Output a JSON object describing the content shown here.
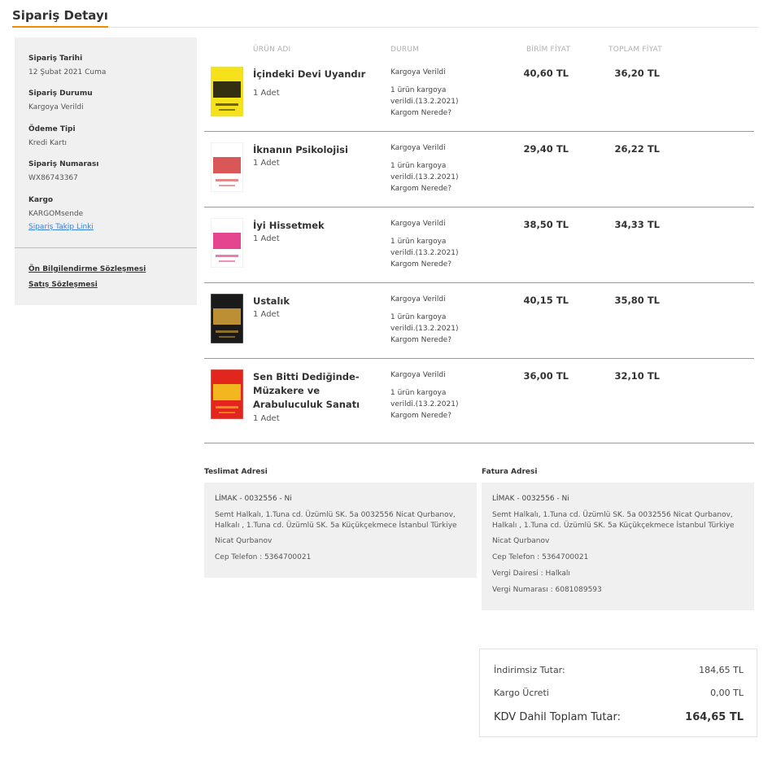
{
  "page": {
    "title": "Sipariş Detayı"
  },
  "sidebar": {
    "order_date": {
      "label": "Sipariş Tarihi",
      "value": "12 Şubat 2021 Cuma"
    },
    "order_status": {
      "label": "Sipariş Durumu",
      "value": "Kargoya Verildi"
    },
    "payment_type": {
      "label": "Ödeme Tipi",
      "value": "Kredi Kartı"
    },
    "order_number": {
      "label": "Sipariş Numarası",
      "value": "WX86743367"
    },
    "cargo": {
      "label": "Kargo",
      "value": "KARGOMsende",
      "tracking_link": "Sipariş Takip Linki"
    },
    "contracts": [
      "Ön Bilgilendirme Sözleşmesi",
      "Satış Sözleşmesi"
    ]
  },
  "table": {
    "headers": {
      "product": "ÜRÜN ADI",
      "status": "DURUM",
      "unit_price": "BİRİM FİYAT",
      "total_price": "TOPLAM FİYAT"
    },
    "items": [
      {
        "name": "İçindeki Devi Uyandır",
        "qty": "1 Adet",
        "status": "Kargoya Verildi",
        "status_detail": "1 ürün kargoya verildi.(13.2.2021)",
        "tracking": "Kargom Nerede?",
        "unit_price": "40,60 TL",
        "total_price": "36,20 TL",
        "cover": {
          "icon": "book-cover-icon",
          "colors": [
            "#f5e21a",
            "#111111"
          ],
          "text": "DEVİ"
        }
      },
      {
        "name": "İknanın Psikolojisi",
        "qty": "1 Adet",
        "status": "Kargoya Verildi",
        "status_detail": "1 ürün kargoya verildi.(13.2.2021)",
        "tracking": "Kargom Nerede?",
        "unit_price": "29,40 TL",
        "total_price": "26,22 TL",
        "cover": {
          "icon": "book-cover-icon",
          "colors": [
            "#ffffff",
            "#d23a3a"
          ],
          "text": "İKNANIN PSİKOLOJİSİ"
        }
      },
      {
        "name": "İyi Hissetmek",
        "qty": "1 Adet",
        "status": "Kargoya Verildi",
        "status_detail": "1 ürün kargoya verildi.(13.2.2021)",
        "tracking": "Kargom Nerede?",
        "unit_price": "38,50 TL",
        "total_price": "34,33 TL",
        "cover": {
          "icon": "book-cover-icon",
          "colors": [
            "#ffffff",
            "#e0247a"
          ],
          "text": "İYİ"
        }
      },
      {
        "name": "Ustalık",
        "qty": "1 Adet",
        "status": "Kargoya Verildi",
        "status_detail": "1 ürün kargoya verildi.(13.2.2021)",
        "tracking": "Kargom Nerede?",
        "unit_price": "40,15 TL",
        "total_price": "35,80 TL",
        "cover": {
          "icon": "book-cover-icon",
          "colors": [
            "#1a1a1a",
            "#d9a53a"
          ],
          "text": "USTALIK"
        }
      },
      {
        "name": "Sen Bitti Dediğinde-Müzakere ve Arabuluculuk Sanatı",
        "qty": "1 Adet",
        "status": "Kargoya Verildi",
        "status_detail": "1 ürün kargoya verildi.(13.2.2021)",
        "tracking": "Kargom Nerede?",
        "unit_price": "36,00 TL",
        "total_price": "32,10 TL",
        "cover": {
          "icon": "book-cover-icon",
          "colors": [
            "#e2261d",
            "#f5d020"
          ],
          "text": "SEN BİTTİ DEDİĞİNDE"
        }
      }
    ]
  },
  "delivery_address": {
    "title": "Teslimat Adresi",
    "name": "LİMAK - 0032556 - Ni",
    "address": "Semt Halkalı, 1.Tuna cd. Üzümlü SK. 5a 0032556 Nicat Qurbanov, Halkalı , 1.Tuna cd. Üzümlü SK. 5a Küçükçekmece İstanbul Türkiye",
    "recipient": "Nicat Qurbanov",
    "phone": "Cep Telefon : 5364700021"
  },
  "billing_address": {
    "title": "Fatura Adresi",
    "name": "LİMAK - 0032556 - Ni",
    "address": "Semt Halkalı, 1.Tuna cd. Üzümlü SK. 5a 0032556 Nicat Qurbanov, Halkalı , 1.Tuna cd. Üzümlü SK. 5a Küçükçekmece İstanbul Türkiye",
    "recipient": "Nicat Qurbanov",
    "phone": "Cep Telefon : 5364700021",
    "tax_office": "Vergi Dairesi : Halkalı",
    "tax_number": "Vergi Numarası : 6081089593"
  },
  "summary": {
    "undiscounted_label": "İndirimsiz Tutar:",
    "undiscounted_value": "184,65 TL",
    "shipping_label": "Kargo Ücreti",
    "shipping_value": "0,00 TL",
    "total_label": "KDV Dahil Toplam Tutar:",
    "total_value": "164,65 TL"
  },
  "colors": {
    "accent": "#f28b00",
    "link": "#3a7fd6",
    "panel": "#f0f0f0"
  }
}
